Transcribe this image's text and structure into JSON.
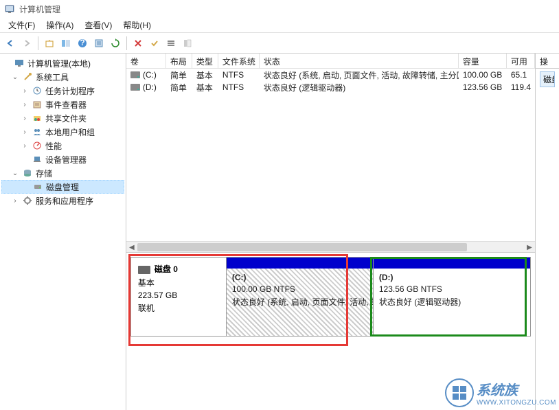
{
  "title": "计算机管理",
  "menu": {
    "file": "文件(F)",
    "action": "操作(A)",
    "view": "查看(V)",
    "help": "帮助(H)"
  },
  "tree": {
    "root": "计算机管理(本地)",
    "system_tools": "系统工具",
    "task_scheduler": "任务计划程序",
    "event_viewer": "事件查看器",
    "shared_folders": "共享文件夹",
    "local_users": "本地用户和组",
    "performance": "性能",
    "device_manager": "设备管理器",
    "storage": "存储",
    "disk_management": "磁盘管理",
    "services": "服务和应用程序"
  },
  "columns": {
    "volume": "卷",
    "layout": "布局",
    "type": "类型",
    "filesystem": "文件系统",
    "status": "状态",
    "capacity": "容量",
    "free": "可用"
  },
  "volumes": [
    {
      "letter": "(C:)",
      "layout": "简单",
      "type": "基本",
      "fs": "NTFS",
      "status": "状态良好 (系统, 启动, 页面文件, 活动, 故障转储, 主分区)",
      "capacity": "100.00 GB",
      "free": "65.1"
    },
    {
      "letter": "(D:)",
      "layout": "简单",
      "type": "基本",
      "fs": "NTFS",
      "status": "状态良好 (逻辑驱动器)",
      "capacity": "123.56 GB",
      "free": "119.4"
    }
  ],
  "disk": {
    "name": "磁盘 0",
    "type": "基本",
    "size": "223.57 GB",
    "state": "联机",
    "parts": [
      {
        "letter": "(C:)",
        "size": "100.00 GB NTFS",
        "status": "状态良好 (系统, 启动, 页面文件, 活动, 故障转储, 主分区)"
      },
      {
        "letter": "(D:)",
        "size": "123.56 GB NTFS",
        "status": "状态良好 (逻辑驱动器)"
      }
    ]
  },
  "actions": {
    "header": "操作",
    "item": "磁盘"
  },
  "watermark": {
    "brand": "系统族",
    "url": "WWW.XITONGZU.COM"
  }
}
